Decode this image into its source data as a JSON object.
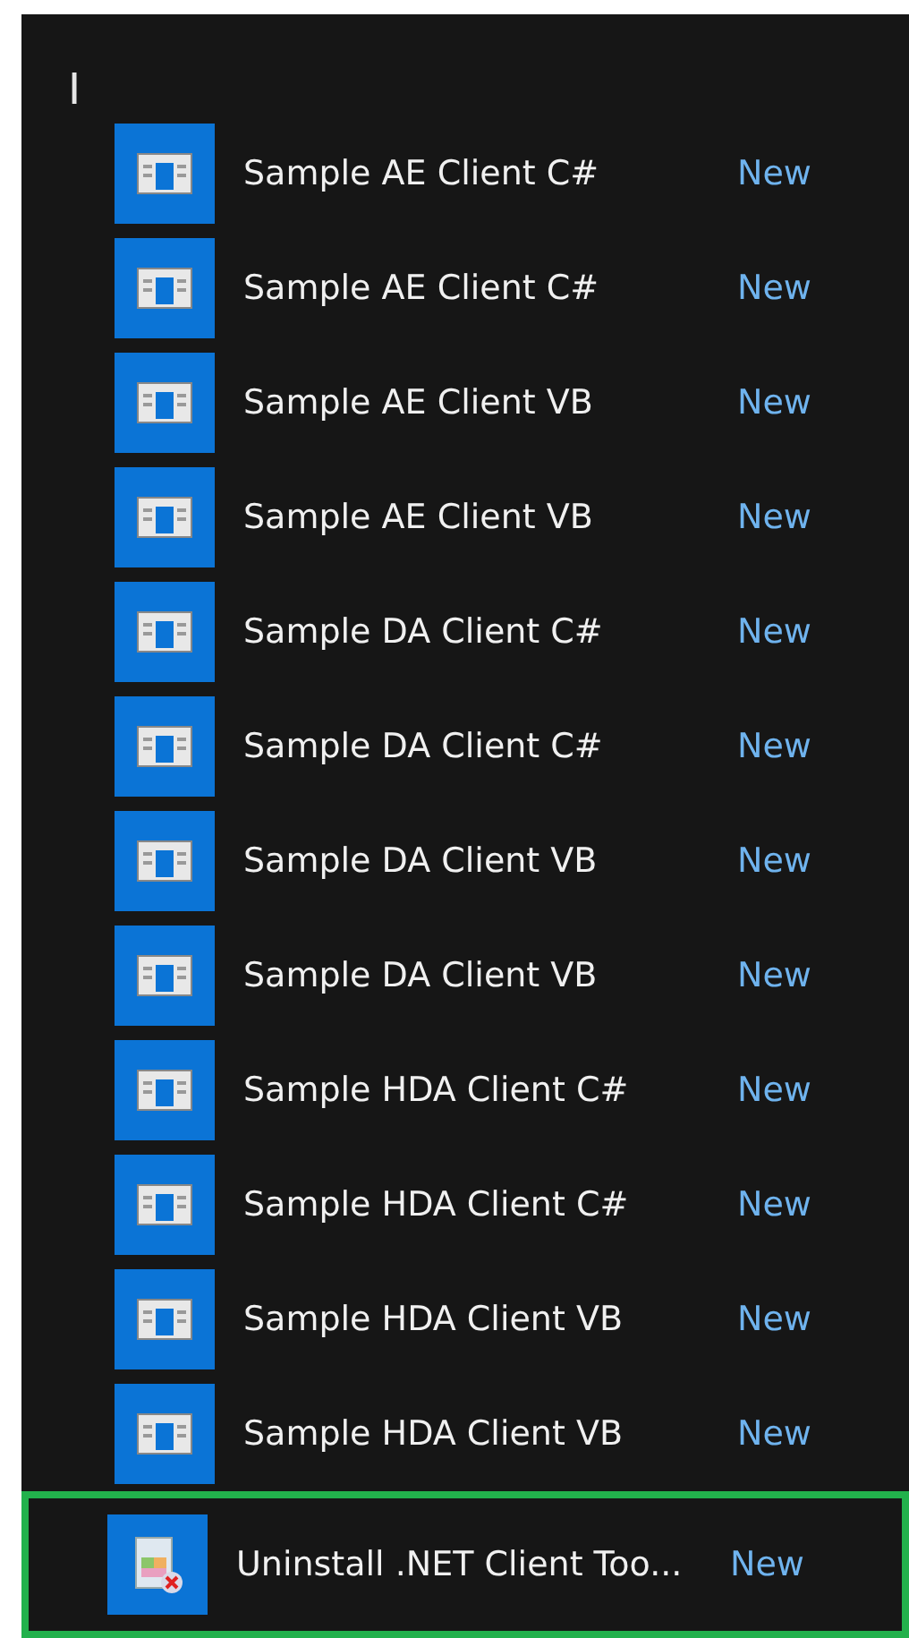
{
  "group_letter": "I",
  "apps": [
    {
      "name": "Sample AE Client C#",
      "badge": "New",
      "kind": "app",
      "highlighted": false
    },
    {
      "name": "Sample AE Client C#",
      "badge": "New",
      "kind": "app",
      "highlighted": false
    },
    {
      "name": "Sample AE Client VB",
      "badge": "New",
      "kind": "app",
      "highlighted": false
    },
    {
      "name": "Sample AE Client VB",
      "badge": "New",
      "kind": "app",
      "highlighted": false
    },
    {
      "name": "Sample DA Client C#",
      "badge": "New",
      "kind": "app",
      "highlighted": false
    },
    {
      "name": "Sample DA Client C#",
      "badge": "New",
      "kind": "app",
      "highlighted": false
    },
    {
      "name": "Sample DA Client VB",
      "badge": "New",
      "kind": "app",
      "highlighted": false
    },
    {
      "name": "Sample DA Client VB",
      "badge": "New",
      "kind": "app",
      "highlighted": false
    },
    {
      "name": "Sample HDA Client C#",
      "badge": "New",
      "kind": "app",
      "highlighted": false
    },
    {
      "name": "Sample HDA Client C#",
      "badge": "New",
      "kind": "app",
      "highlighted": false
    },
    {
      "name": "Sample HDA Client VB",
      "badge": "New",
      "kind": "app",
      "highlighted": false
    },
    {
      "name": "Sample HDA Client VB",
      "badge": "New",
      "kind": "app",
      "highlighted": false
    },
    {
      "name": "Uninstall .NET Client Too...",
      "badge": "New",
      "kind": "uninstaller",
      "highlighted": true
    }
  ]
}
